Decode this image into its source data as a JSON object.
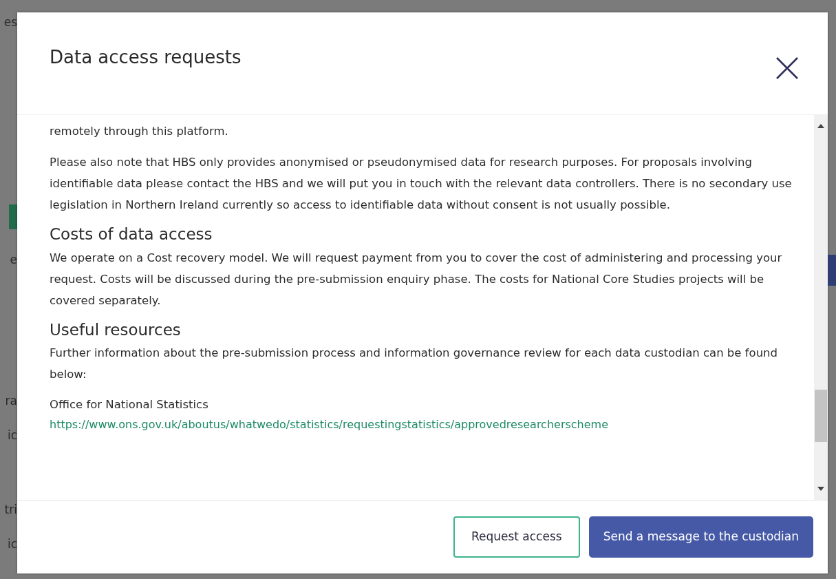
{
  "background": {
    "fragments": [
      "es",
      "e",
      "ra",
      "ic",
      "tri",
      "ic"
    ]
  },
  "dialog": {
    "title": "Data access requests",
    "body": [
      {
        "kind": "paragraph",
        "text": "remotely through this platform."
      },
      {
        "kind": "paragraph",
        "text": "Please also note that HBS only provides anonymised or pseudonymised data for research purposes. For proposals involving identifiable data please contact the HBS and we will put you in touch with the relevant data controllers. There is no secondary use legislation in Northern Ireland currently so access to identifiable data without consent is not usually possible."
      },
      {
        "kind": "heading",
        "text": "Costs of data access"
      },
      {
        "kind": "paragraph",
        "text": "We operate on a Cost recovery model. We will request payment from you to cover the cost of administering and processing your request. Costs will be discussed during the pre-submission enquiry phase. The costs for National Core Studies projects will be covered separately."
      },
      {
        "kind": "heading",
        "text": "Useful resources"
      },
      {
        "kind": "paragraph",
        "text": "Further information about the pre-submission process and information governance review for each data custodian can be found below:"
      },
      {
        "kind": "resource",
        "name": "Office for National Statistics",
        "url": "https://www.ons.gov.uk/aboutus/whatwedo/statistics/requestingstatistics/approvedresearcherscheme"
      }
    ],
    "buttons": [
      {
        "label": "Request access",
        "kind": "outline"
      },
      {
        "label": "Send a message to the custodian",
        "kind": "primary"
      }
    ]
  }
}
